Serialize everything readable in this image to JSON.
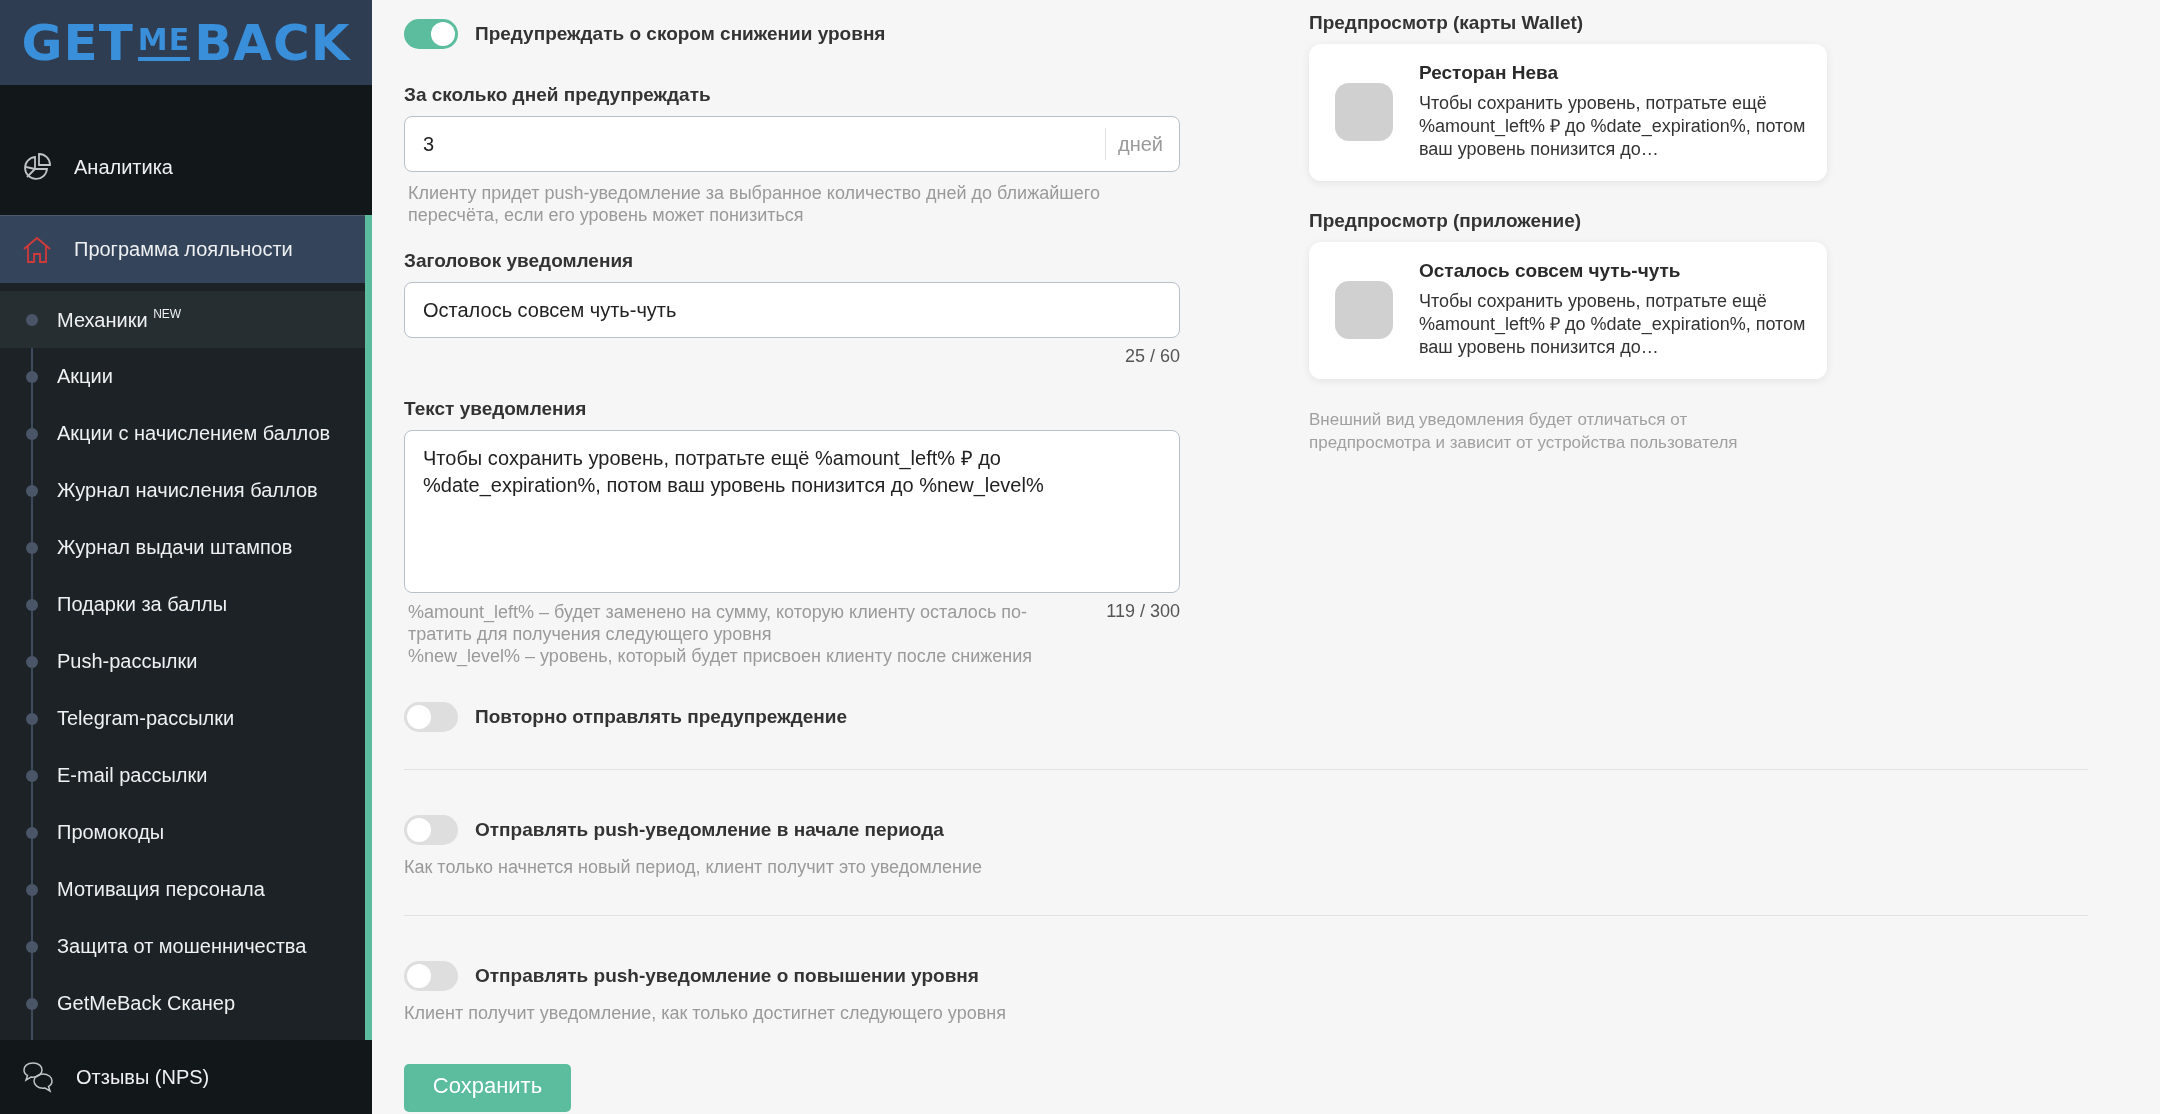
{
  "sidebar": {
    "logo": {
      "left": "GET",
      "middle": "ME",
      "right": "BACK"
    },
    "nav": [
      {
        "label": "Аналитика",
        "selected": false
      },
      {
        "label": "Программа лояльности",
        "selected": true,
        "children": [
          {
            "label": "Механики $^{NEW}$",
            "selected": true
          },
          {
            "label": "Акции",
            "selected": false
          },
          {
            "label": "Акции с начислением баллов",
            "selected": false
          },
          {
            "label": "Журнал начисления баллов",
            "selected": false
          },
          {
            "label": "Журнал выдачи штампов",
            "selected": false
          },
          {
            "label": "Подарки за баллы",
            "selected": false
          },
          {
            "label": "Push-рассылки",
            "selected": false
          },
          {
            "label": "Telegram-рассылки",
            "selected": false
          },
          {
            "label": "E-mail рассылки",
            "selected": false
          },
          {
            "label": "Промокоды",
            "selected": false
          },
          {
            "label": "Мотивация персонала",
            "selected": false
          },
          {
            "label": "Защита от мошенничества",
            "selected": false
          },
          {
            "label": "GetMeBack Сканер",
            "selected": false
          }
        ]
      },
      {
        "label": "Отзывы (NPS)",
        "selected": false
      }
    ]
  },
  "settings": [
    {
      "kind": "toggle",
      "label": "Предупреждать о скором снижении уровня",
      "on": true
    },
    {
      "kind": "number",
      "label": "За сколько дней предупреждать",
      "value": "3",
      "unit": "дней",
      "hint": "Клиенту придет push-уведомление за выбранное количество дней до ближайшего пересчёта, если его уровень может понизиться"
    },
    {
      "kind": "text",
      "label": "Заголовок уведомления",
      "value": "Осталось совсем чуть-чуть",
      "counter": "25 / 60"
    },
    {
      "kind": "textarea",
      "label": "Текст уведомления",
      "value": "Чтобы сохранить уровень, потратьте ещё %amount_left% ₽ до %date_expiration%, потом ваш уровень понизится до %new_level%",
      "counter": "119 / 300",
      "hints": [
        "%amount_left% – будет заменено на сумму, которую клиенту осталось по-тратить для получения следующего уровня",
        "%new_level% – уровень, который будет присвоен клиенту после снижения"
      ]
    },
    {
      "kind": "toggle",
      "label": "Повторно отправлять предупреждение",
      "on": false
    },
    {
      "kind": "divider"
    },
    {
      "kind": "toggle",
      "label": "Отправлять push-уведомление в начале периода",
      "on": false,
      "hint": "Как только начнется новый период, клиент получит это уведомление"
    },
    {
      "kind": "divider"
    },
    {
      "kind": "toggle",
      "label": "Отправлять push-уведомление о повышении уровня",
      "on": false,
      "hint": "Клиент получит уведомление, как только достигнет следующего уровня"
    }
  ],
  "save_button": "Сохранить",
  "previews": [
    {
      "label": "Предпросмотр (карты Wallet)",
      "title": "Ресторан Нева",
      "text": "Чтобы сохранить уровень, потратьте ещё %amount_left% ₽ до %date_expiration%, потом ваш уровень понизится до…"
    },
    {
      "label": "Предпросмотр (приложение)",
      "title": "Осталось совсем чуть-чуть",
      "text": "Чтобы сохранить уровень, потратьте ещё %amount_left% ₽ до %date_expiration%, потом ваш уровень понизится до…"
    }
  ],
  "preview_note": "Внешний вид уведомления будет отличаться от предпросмотра и зависит от устройства пользователя"
}
